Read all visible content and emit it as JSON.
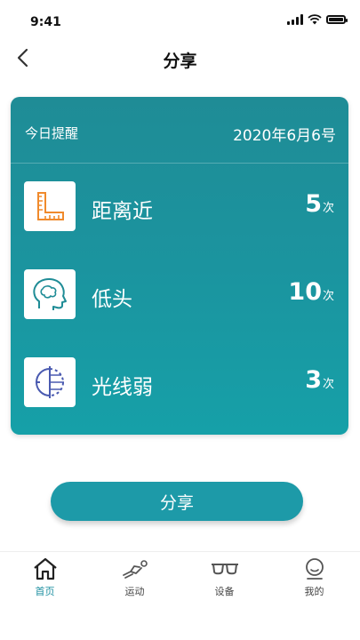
{
  "status": {
    "time": "9:41"
  },
  "nav": {
    "title": "分享"
  },
  "card": {
    "label": "今日提醒",
    "date": "2020年6月6号",
    "rows": [
      {
        "name": "距离近",
        "count": "5",
        "unit": "次",
        "icon": "ruler-icon"
      },
      {
        "name": "低头",
        "count": "10",
        "unit": "次",
        "icon": "head-icon"
      },
      {
        "name": "光线弱",
        "count": "3",
        "unit": "次",
        "icon": "light-icon"
      }
    ]
  },
  "share_button": "分享",
  "tabs": [
    {
      "label": "首页",
      "icon": "home-icon",
      "active": true
    },
    {
      "label": "运动",
      "icon": "run-icon",
      "active": false
    },
    {
      "label": "设备",
      "icon": "glasses-icon",
      "active": false
    },
    {
      "label": "我的",
      "icon": "user-icon",
      "active": false
    }
  ],
  "colors": {
    "accent": "#1d9aa8",
    "card_top": "#1f8c96",
    "card_bottom": "#16a0a8",
    "ruler": "#f08a2c",
    "head": "#1f8c96",
    "light": "#4a5ab0"
  }
}
